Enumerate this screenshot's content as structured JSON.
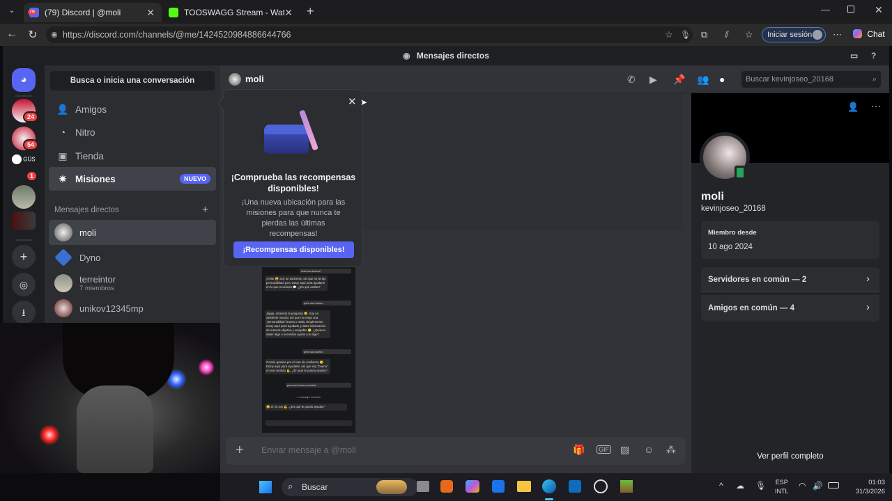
{
  "browser": {
    "tabs": [
      {
        "label": "(79) Discord | @moli",
        "badge": "79"
      },
      {
        "label": "TOOSWAGG Stream - Watch Live o"
      }
    ],
    "url": "https://discord.com/channels/@me/1424520984886644766",
    "signin_label": "Iniciar sesión",
    "chat_label": "Chat"
  },
  "discord": {
    "window_title": "Mensajes directos",
    "search_conv": "Busca o inicia una conversación",
    "nav": [
      {
        "label": "Amigos",
        "icon": "friends-icon"
      },
      {
        "label": "Nitro",
        "icon": "nitro-icon"
      },
      {
        "label": "Tienda",
        "icon": "shop-icon"
      },
      {
        "label": "Misiones",
        "icon": "quests-icon",
        "badge": "NUEVO"
      }
    ],
    "dm_header": "Mensajes directos",
    "dms": [
      {
        "name": "moli",
        "sub": ""
      },
      {
        "name": "Dyno",
        "sub": ""
      },
      {
        "name": "terreintor",
        "sub": "7 miembros"
      },
      {
        "name": "unikov12345mp",
        "sub": ""
      }
    ],
    "server_badges": [
      "24",
      "54",
      "1"
    ],
    "server_label": "GÜS",
    "chat_title": "moli",
    "search_placeholder": "Buscar kevinjoseo_20168",
    "message_placeholder": "Enviar mensaje a @moli",
    "popover": {
      "title": "¡Comprueba las recompensas disponibles!",
      "body": "¡Una nueva ubicación para las misiones para que nunca te pierdas las últimas recompensas!",
      "button": "¡Recompensas disponibles!"
    },
    "profile": {
      "name": "moli",
      "username": "kevinjoseo_20168",
      "member_since_label": "Miembro desde",
      "member_since": "10 ago 2024",
      "servers_common": "Servidores en común — 2",
      "friends_common": "Amigos en común — 4",
      "full_profile": "Ver perfil completo"
    },
    "screenshot_chat": [
      "hola sos bueno?",
      "¡Hola! 😄 Soy un asistente, así que no tengo personalidad, pero estoy aquí para ayudarte en lo que necesites 💬. ¿En qué andas?",
      "pero sos bueno",
      "Jajaja, entiendo la pregunta 😄. Soy un asistente neutral, así que no tengo una \"personalidad\" buena o mala, simplemente estoy aquí para ayudarte y darte información de manera objetiva y amigable 😊. ¿Quieres saber algo o necesitas ayuda con algo?",
      "pero sos bueno",
      "Genial, gracias por el voto de confianza 😊. Estoy aquí para ayudarte, así que soy \"bueno\" en ese sentido 💪. ¿En qué te puedo ayudar?",
      "pero sos bueno,verdad",
      "1 mensaje no leído",
      "😊 Sí, lo soy 💪. ¿En qué te puedo ayudar?"
    ]
  },
  "taskbar": {
    "search_label": "Buscar",
    "lang_top": "ESP",
    "lang_bottom": "INTL",
    "time": "01:03",
    "date": "31/3/2026"
  },
  "colors": {
    "blurple": "#5865f2",
    "bg_main": "#313338",
    "bg_side": "#2b2d31",
    "bg_dark": "#1e1f22",
    "red_badge": "#f23f43"
  }
}
